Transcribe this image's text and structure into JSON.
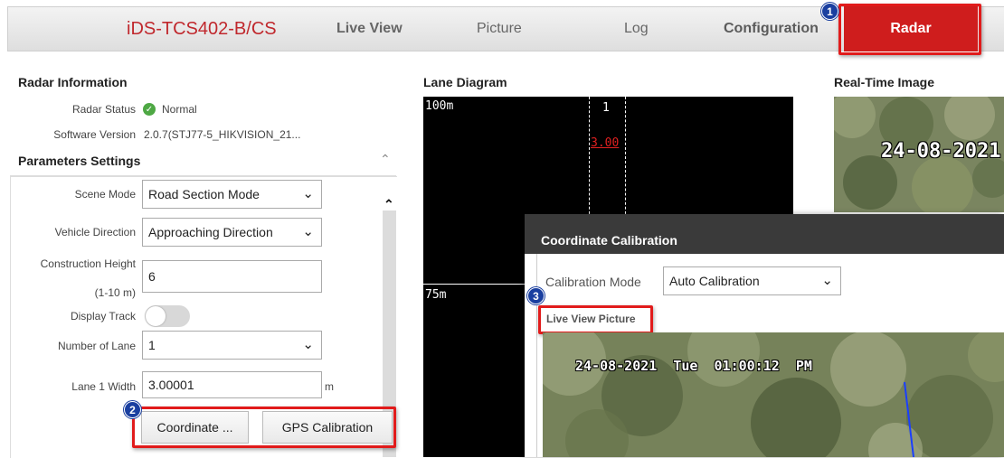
{
  "nav": {
    "brand": "iDS-TCS402-B/CS",
    "items": [
      "Live View",
      "Picture",
      "Log",
      "Configuration"
    ],
    "active": "Radar"
  },
  "badges": [
    "1",
    "2",
    "3"
  ],
  "radar_info": {
    "title": "Radar Information",
    "status_label": "Radar Status",
    "status_value": "Normal",
    "software_label": "Software Version",
    "software_value": "2.0.7(STJ77-5_HIKVISION_21..."
  },
  "params": {
    "title": "Parameters Settings",
    "scene_mode_label": "Scene Mode",
    "scene_mode_value": "Road Section Mode",
    "vehicle_direction_label": "Vehicle Direction",
    "vehicle_direction_value": "Approaching Direction",
    "construction_height_label": "Construction Height",
    "construction_height_range": "(1-10 m)",
    "construction_height_value": "6",
    "display_track_label": "Display Track",
    "display_track_on": false,
    "number_of_lane_label": "Number of Lane",
    "number_of_lane_value": "1",
    "lane_width_label": "Lane 1 Width",
    "lane_width_value": "3.00001",
    "lane_width_unit": "m",
    "coordinate_button": "Coordinate ...",
    "gps_button": "GPS Calibration"
  },
  "lane_diagram": {
    "title": "Lane Diagram",
    "distance_top": "100m",
    "distance_mid": "75m",
    "lane_number": "1",
    "lane_width": "3.00"
  },
  "real_time": {
    "title": "Real-Time Image",
    "osd": "24-08-2021"
  },
  "dialog": {
    "title": "Coordinate Calibration",
    "calibration_mode_label": "Calibration Mode",
    "calibration_mode_value": "Auto Calibration",
    "live_view_picture_label": "Live View Picture",
    "osd": "24-08-2021  Tue  01:00:12  PM"
  },
  "colors": {
    "brand_red": "#c0282d",
    "active_tab": "#cf1d1d",
    "highlight": "#e11b1b",
    "badge_blue": "#1a3fa0",
    "status_green": "#4ea844"
  }
}
